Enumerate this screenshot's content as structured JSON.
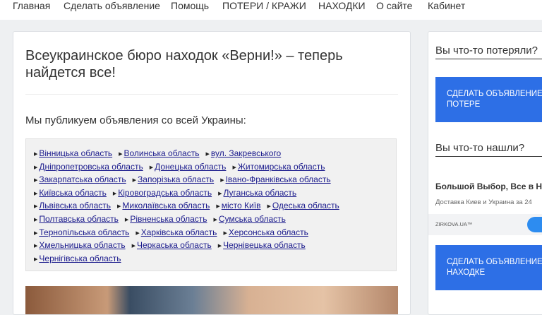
{
  "nav": {
    "items": [
      "Главная",
      "Сделать объявление",
      "Помощь",
      "ПОТЕРИ / КРАЖИ",
      "НАХОДКИ",
      "О сайте",
      "Кабинет"
    ]
  },
  "main": {
    "title": "Всеукраинское бюро находок «Верни!» – теперь найдется все!",
    "subtitle": "Мы публикуем объявления со всей Украины:",
    "regions": [
      [
        "Вінницька область",
        "Волинська область",
        "вул. Закревського"
      ],
      [
        "Дніпропетровська область",
        "Донецька область",
        "Житомирська область"
      ],
      [
        "Закарпатська область",
        "Запорізька область",
        "Івано-Франківська область"
      ],
      [
        "Київська область",
        "Кіровоградська область",
        "Луганська область"
      ],
      [
        "Львівська область",
        "Миколаївська область",
        "місто Київ",
        "Одеська область"
      ],
      [
        "Полтавська область",
        "Рівненська область",
        "Сумська область"
      ],
      [
        "Тернопільська область",
        "Харківська область",
        "Херсонська область"
      ],
      [
        "Хмельницька область",
        "Черкаська область",
        "Чернівецька область"
      ],
      [
        "Чернігівська область"
      ]
    ]
  },
  "sidebar": {
    "lost_heading": "Вы что-то потеряли?",
    "lost_button": "СДЕЛАТЬ ОБЪЯВЛЕНИЕ О ПОТЕРЕ",
    "found_heading": "Вы что-то нашли?",
    "ad_title": "Большой Выбор, Все в Н",
    "ad_sub": "Доставка Киев и Украина за 24",
    "ad_brand": "ZIRKOVA.UA™",
    "found_button": "СДЕЛАТЬ ОБЪЯВЛЕНИЕ О НАХОДКЕ",
    "accent_color": "#2d6fe6"
  }
}
